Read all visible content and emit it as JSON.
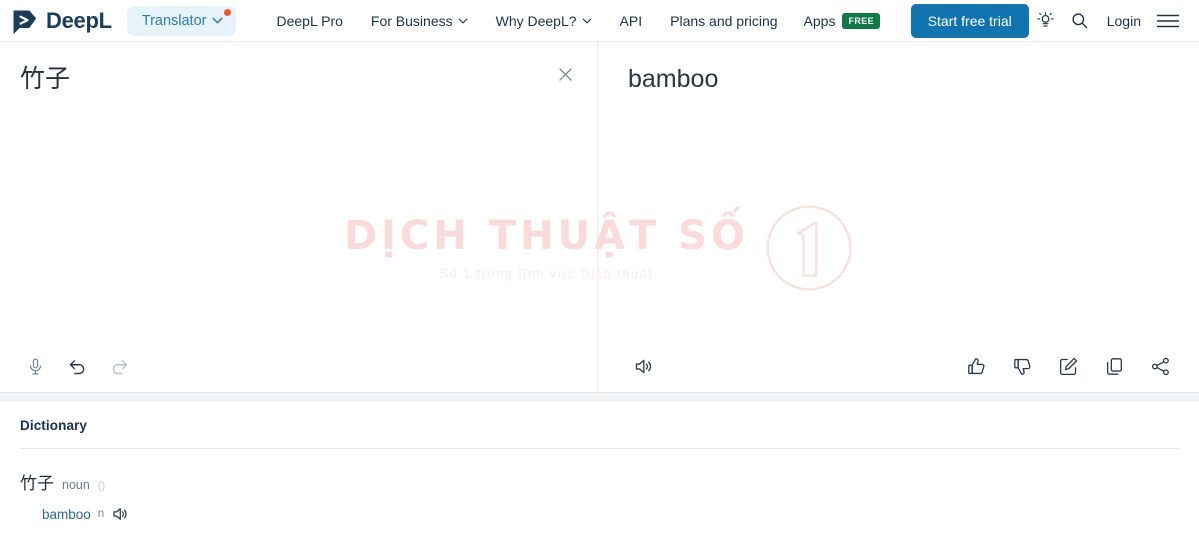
{
  "header": {
    "brand": "DeepL",
    "product_switcher": {
      "label": "Translator",
      "has_notification_dot": true
    },
    "nav": [
      {
        "label": "DeepL Pro",
        "has_caret": false
      },
      {
        "label": "For Business",
        "has_caret": true
      },
      {
        "label": "Why DeepL?",
        "has_caret": true
      },
      {
        "label": "API",
        "has_caret": false
      },
      {
        "label": "Plans and pricing",
        "has_caret": false
      }
    ],
    "apps": {
      "label": "Apps",
      "badge": "FREE"
    },
    "cta": "Start free trial",
    "login": "Login",
    "icons": {
      "idea": "lightbulb-icon",
      "search": "search-icon",
      "menu": "hamburger-menu-icon"
    }
  },
  "source_panel": {
    "text": "竹子",
    "clear_label": "×",
    "tools": [
      "microphone-icon",
      "undo-icon",
      "redo-icon"
    ]
  },
  "target_panel": {
    "text": "bamboo",
    "tools": [
      "speaker-icon",
      "thumbs-up-icon",
      "thumbs-down-icon",
      "edit-icon",
      "copy-icon",
      "share-icon"
    ]
  },
  "watermark": {
    "title": "DỊCH THUẬT SỐ",
    "subtitle": "Số 1 trong lĩnh vực Dịch thuật",
    "logo_digit": "1"
  },
  "dictionary": {
    "title": "Dictionary",
    "entries": [
      {
        "word": "竹子",
        "pos": "noun",
        "marker": "()",
        "senses": [
          {
            "word": "bamboo",
            "pos": "n",
            "audio": "speaker-icon"
          }
        ]
      }
    ]
  },
  "colors": {
    "accent_blue": "#0f74af",
    "badge_green": "#0b7a45",
    "notification_orange": "#f05a22",
    "pill_bg": "#e6f3fa",
    "pill_text": "#2c7fa8",
    "watermark_pink": "#fadadb"
  }
}
